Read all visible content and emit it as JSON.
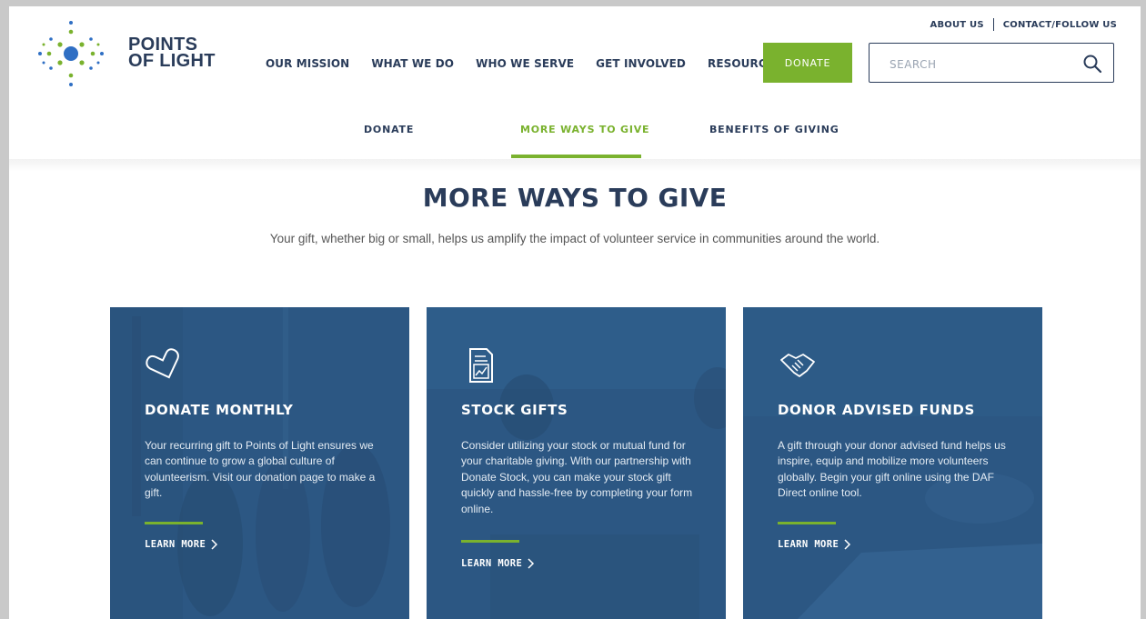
{
  "brand": {
    "line1": "POINTS",
    "line2": "OF LIGHT"
  },
  "top_links": [
    "ABOUT US",
    "CONTACT/FOLLOW US"
  ],
  "nav": [
    "OUR MISSION",
    "WHAT WE DO",
    "WHO WE SERVE",
    "GET INVOLVED",
    "RESOURCES"
  ],
  "donate_button": "DONATE",
  "search": {
    "placeholder": "SEARCH",
    "icon": "search-icon"
  },
  "subnav": {
    "items": [
      "DONATE",
      "MORE WAYS TO GIVE",
      "BENEFITS OF GIVING"
    ],
    "active": "MORE WAYS TO GIVE"
  },
  "hero": {
    "title": "MORE WAYS TO GIVE",
    "subtitle": "Your gift, whether big or small, helps us amplify the impact of volunteer service in communities around the world."
  },
  "cards": [
    {
      "icon": "heart-outline-icon",
      "title": "DONATE MONTHLY",
      "desc": "Your recurring gift to Points of Light ensures we can continue to grow a global culture of volunteerism. Visit our donation page to make a gift.",
      "link": "LEARN MORE"
    },
    {
      "icon": "stock-chart-document-icon",
      "title": "STOCK GIFTS",
      "desc": "Consider utilizing your stock or mutual fund for your charitable giving. With our partnership with Donate Stock, you can make your stock gift quickly and hassle-free by completing your form online.",
      "link": "LEARN MORE"
    },
    {
      "icon": "handshake-icon",
      "title": "DONOR ADVISED FUNDS",
      "desc": "A gift through your donor advised fund helps us inspire, equip and mobilize more volunteers globally. Begin your gift online using the DAF Direct online tool.",
      "link": "LEARN MORE"
    }
  ],
  "colors": {
    "navy": "#2a3c5a",
    "green": "#7ab22e",
    "card_blue": "#2c5783",
    "logo_blue": "#2f6fc4"
  }
}
